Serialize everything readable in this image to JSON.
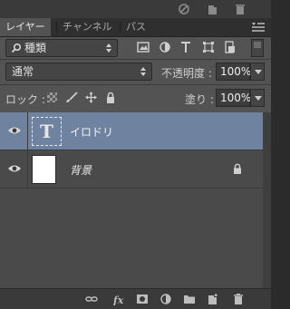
{
  "tabs": [
    {
      "label": "レイヤー"
    },
    {
      "label": "チャンネル"
    },
    {
      "label": "パス"
    }
  ],
  "filter": {
    "kind_label": "種類"
  },
  "blend": {
    "mode": "通常",
    "opacity_label": "不透明度 :",
    "opacity_value": "100%"
  },
  "lock": {
    "label": "ロック :",
    "fill_label": "塗り :",
    "fill_value": "100%"
  },
  "layers": [
    {
      "name": "イロドリ",
      "type": "text",
      "thumb_glyph": "T",
      "selected": true
    },
    {
      "name": "背景",
      "type": "background",
      "locked": true
    }
  ],
  "colors": {
    "selection": "#6f83a0",
    "panel": "#535353"
  }
}
